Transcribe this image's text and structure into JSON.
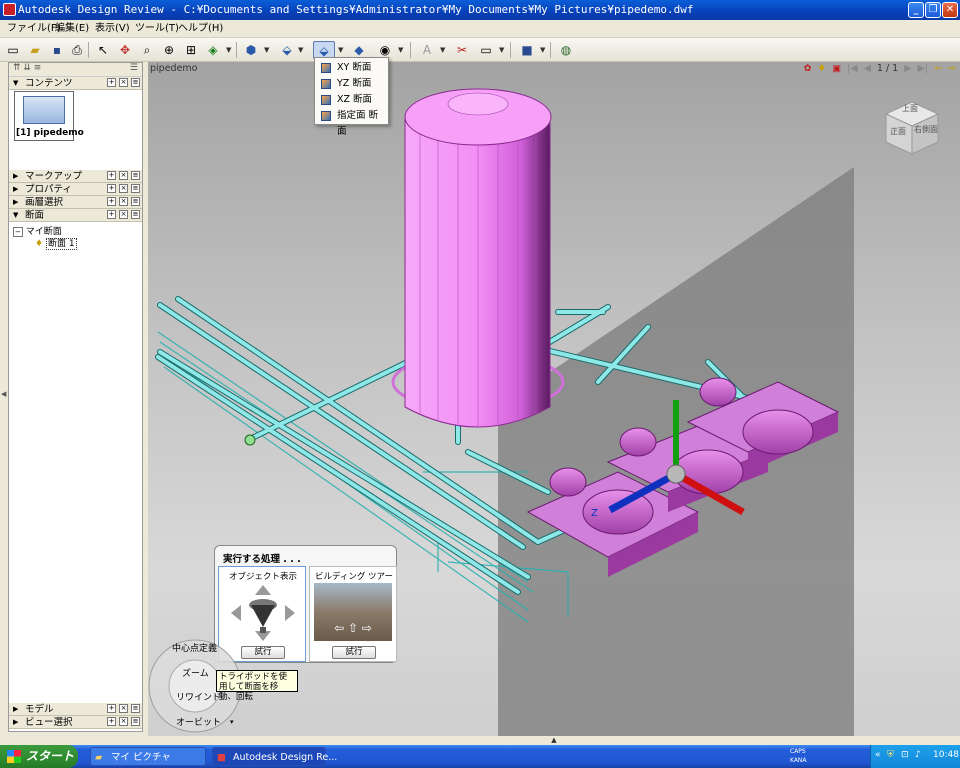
{
  "window": {
    "title": "Autodesk Design Review - C:¥Documents and Settings¥Administrator¥My Documents¥My Pictures¥pipedemo.dwf"
  },
  "menu": [
    "ファイル(F)",
    "編集(E)",
    "表示(V)",
    "ツール(T)",
    "ヘルプ(H)"
  ],
  "toolbar": {
    "text_tool_label": "A"
  },
  "dropdown": {
    "items": [
      "XY 断面",
      "YZ 断面",
      "XZ 断面",
      "指定面 断面"
    ]
  },
  "left_panel": {
    "contents_header": "コンテンツ",
    "thumbnail_label": "[1] pipedemo",
    "sections": [
      "マークアップ",
      "プロパティ",
      "画層選択",
      "断面"
    ],
    "tree_root": "マイ断面",
    "tree_child": "断面 1",
    "bottom_sections": [
      "モデル",
      "ビュー選択"
    ]
  },
  "viewport": {
    "title": "pipedemo",
    "page_indicator": "1 / 1"
  },
  "viewcube": {
    "top": "上面",
    "front": "正面",
    "right": "右側面"
  },
  "axis_label": "Z",
  "welcome": {
    "title": "実行する処理 . . .",
    "card1_title": "オブジェクト表示",
    "card1_button": "試行",
    "card2_title": "ビルディング ツアー",
    "card2_button": "試行"
  },
  "wheel": {
    "items": [
      "中心点定義",
      "ズーム",
      "リワインド",
      "オービット"
    ]
  },
  "tooltip": "トライポッドを使用して断面を移動、回転",
  "taskbar": {
    "start": "スタート",
    "tasks": [
      "マイ ピクチャ",
      "Autodesk Design Re..."
    ],
    "caps": "CAPS",
    "kana": "KANA",
    "clock": "10:48"
  },
  "colors": {
    "tank": "#e07ae8",
    "pipe": "#8ee0e0",
    "section_plane": "#7a7a7a",
    "title_bar": "#0a5ed8"
  }
}
